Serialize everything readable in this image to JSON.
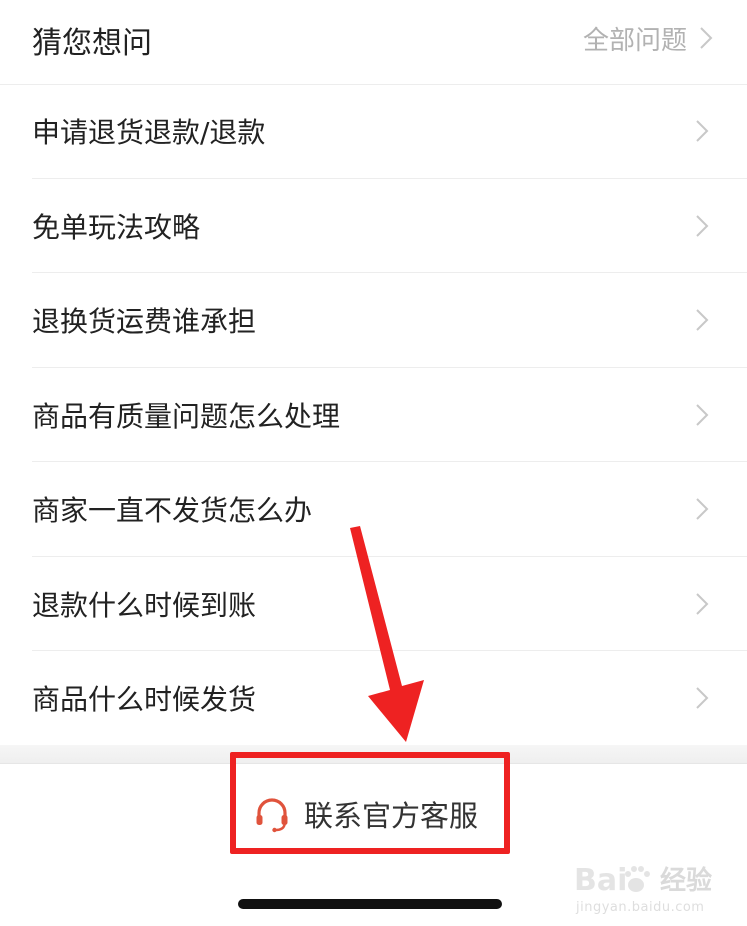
{
  "header": {
    "title": "猜您想问",
    "all_questions_label": "全部问题"
  },
  "questions": [
    {
      "label": "申请退货退款/退款"
    },
    {
      "label": "免单玩法攻略"
    },
    {
      "label": "退换货运费谁承担"
    },
    {
      "label": "商品有质量问题怎么处理"
    },
    {
      "label": "商家一直不发货怎么办"
    },
    {
      "label": "退款什么时候到账"
    },
    {
      "label": "商品什么时候发货"
    }
  ],
  "footer": {
    "service_label": "联系官方客服"
  },
  "watermark": {
    "brand_text": "经验",
    "url": "jingyan.baidu.com"
  },
  "icons": {
    "chevron": "chevron-right-icon",
    "service": "headset-icon"
  },
  "colors": {
    "service_icon": "#e0533c",
    "annotation": "#ee2222",
    "chevron": "#c8c8c8",
    "muted_text": "#b2b2b2"
  }
}
